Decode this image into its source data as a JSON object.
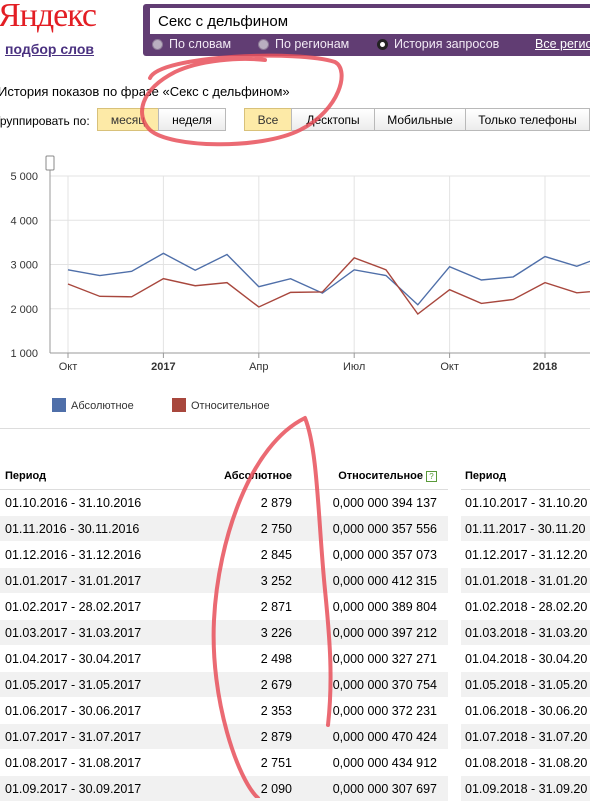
{
  "header": {
    "logo": "Яндекс",
    "subtitle": "подбор слов",
    "search_value": "Секс с дельфином",
    "radios": [
      {
        "label": "По словам",
        "selected": false
      },
      {
        "label": "По регионам",
        "selected": false
      },
      {
        "label": "История запросов",
        "selected": true
      }
    ],
    "region_link": "Все регио"
  },
  "phrase_title": "История показов по фразе «Секс с дельфином»",
  "grouping": {
    "label": "Группировать по:",
    "period_buttons": [
      "месяц",
      "неделя"
    ],
    "device_buttons": [
      "Все",
      "Десктопы",
      "Мобильные",
      "Только телефоны"
    ]
  },
  "colors": {
    "accent_purple": "#613d73",
    "absolute_series": "#4f6fa9",
    "relative_series": "#a8473d",
    "active_button": "#fdeaa7",
    "annotation_red": "#e8505a"
  },
  "chart_data": {
    "type": "line",
    "x": [
      "2016-10",
      "2016-11",
      "2016-12",
      "2017-01",
      "2017-02",
      "2017-03",
      "2017-04",
      "2017-05",
      "2017-06",
      "2017-07",
      "2017-08",
      "2017-09",
      "2017-10",
      "2017-11",
      "2017-12",
      "2018-01",
      "2018-02",
      "2018-03"
    ],
    "series": [
      {
        "name": "Абсолютное",
        "values": [
          2879,
          2750,
          2845,
          3252,
          2871,
          3226,
          2498,
          2679,
          2353,
          2879,
          2751,
          2090,
          2950,
          2650,
          2720,
          3180,
          2960,
          3230
        ]
      },
      {
        "name": "Относительное",
        "values": [
          2560,
          2280,
          2270,
          2680,
          2520,
          2590,
          2040,
          2370,
          2380,
          3150,
          2880,
          1880,
          2430,
          2120,
          2210,
          2590,
          2360,
          2420
        ]
      }
    ],
    "y_ticks": [
      "1 000",
      "2 000",
      "3 000",
      "4 000",
      "5 000"
    ],
    "ylim": [
      1000,
      5000
    ],
    "x_ticks": [
      {
        "label": "Окт",
        "index": 0,
        "bold": false
      },
      {
        "label": "2017",
        "index": 3,
        "bold": true
      },
      {
        "label": "Апр",
        "index": 6,
        "bold": false
      },
      {
        "label": "Июл",
        "index": 9,
        "bold": false
      },
      {
        "label": "Окт",
        "index": 12,
        "bold": false
      },
      {
        "label": "2018",
        "index": 15,
        "bold": true
      }
    ],
    "grid": true,
    "legend_position": "bottom-left"
  },
  "table": {
    "headers": {
      "period": "Период",
      "absolute": "Абсолютное",
      "relative": "Относительное",
      "help": "?",
      "period2": "Период"
    },
    "rows": [
      {
        "period": "01.10.2016 - 31.10.2016",
        "absolute": "2 879",
        "relative": "0,000 000 394 137",
        "period2": "01.10.2017 - 31.10.20"
      },
      {
        "period": "01.11.2016 - 30.11.2016",
        "absolute": "2 750",
        "relative": "0,000 000 357 556",
        "period2": "01.11.2017 - 30.11.20"
      },
      {
        "period": "01.12.2016 - 31.12.2016",
        "absolute": "2 845",
        "relative": "0,000 000 357 073",
        "period2": "01.12.2017 - 31.12.20"
      },
      {
        "period": "01.01.2017 - 31.01.2017",
        "absolute": "3 252",
        "relative": "0,000 000 412 315",
        "period2": "01.01.2018 - 31.01.20"
      },
      {
        "period": "01.02.2017 - 28.02.2017",
        "absolute": "2 871",
        "relative": "0,000 000 389 804",
        "period2": "01.02.2018 - 28.02.20"
      },
      {
        "period": "01.03.2017 - 31.03.2017",
        "absolute": "3 226",
        "relative": "0,000 000 397 212",
        "period2": "01.03.2018 - 31.03.20"
      },
      {
        "period": "01.04.2017 - 30.04.2017",
        "absolute": "2 498",
        "relative": "0,000 000 327 271",
        "period2": "01.04.2018 - 30.04.20"
      },
      {
        "period": "01.05.2017 - 31.05.2017",
        "absolute": "2 679",
        "relative": "0,000 000 370 754",
        "period2": "01.05.2018 - 31.05.20"
      },
      {
        "period": "01.06.2017 - 30.06.2017",
        "absolute": "2 353",
        "relative": "0,000 000 372 231",
        "period2": "01.06.2018 - 30.06.20"
      },
      {
        "period": "01.07.2017 - 31.07.2017",
        "absolute": "2 879",
        "relative": "0,000 000 470 424",
        "period2": "01.07.2018 - 31.07.20"
      },
      {
        "period": "01.08.2017 - 31.08.2017",
        "absolute": "2 751",
        "relative": "0,000 000 434 912",
        "period2": "01.08.2018 - 31.08.20"
      },
      {
        "period": "01.09.2017 - 30.09.2017",
        "absolute": "2 090",
        "relative": "0,000 000 307 697",
        "period2": "01.09.2018 - 31.09.20"
      }
    ]
  }
}
